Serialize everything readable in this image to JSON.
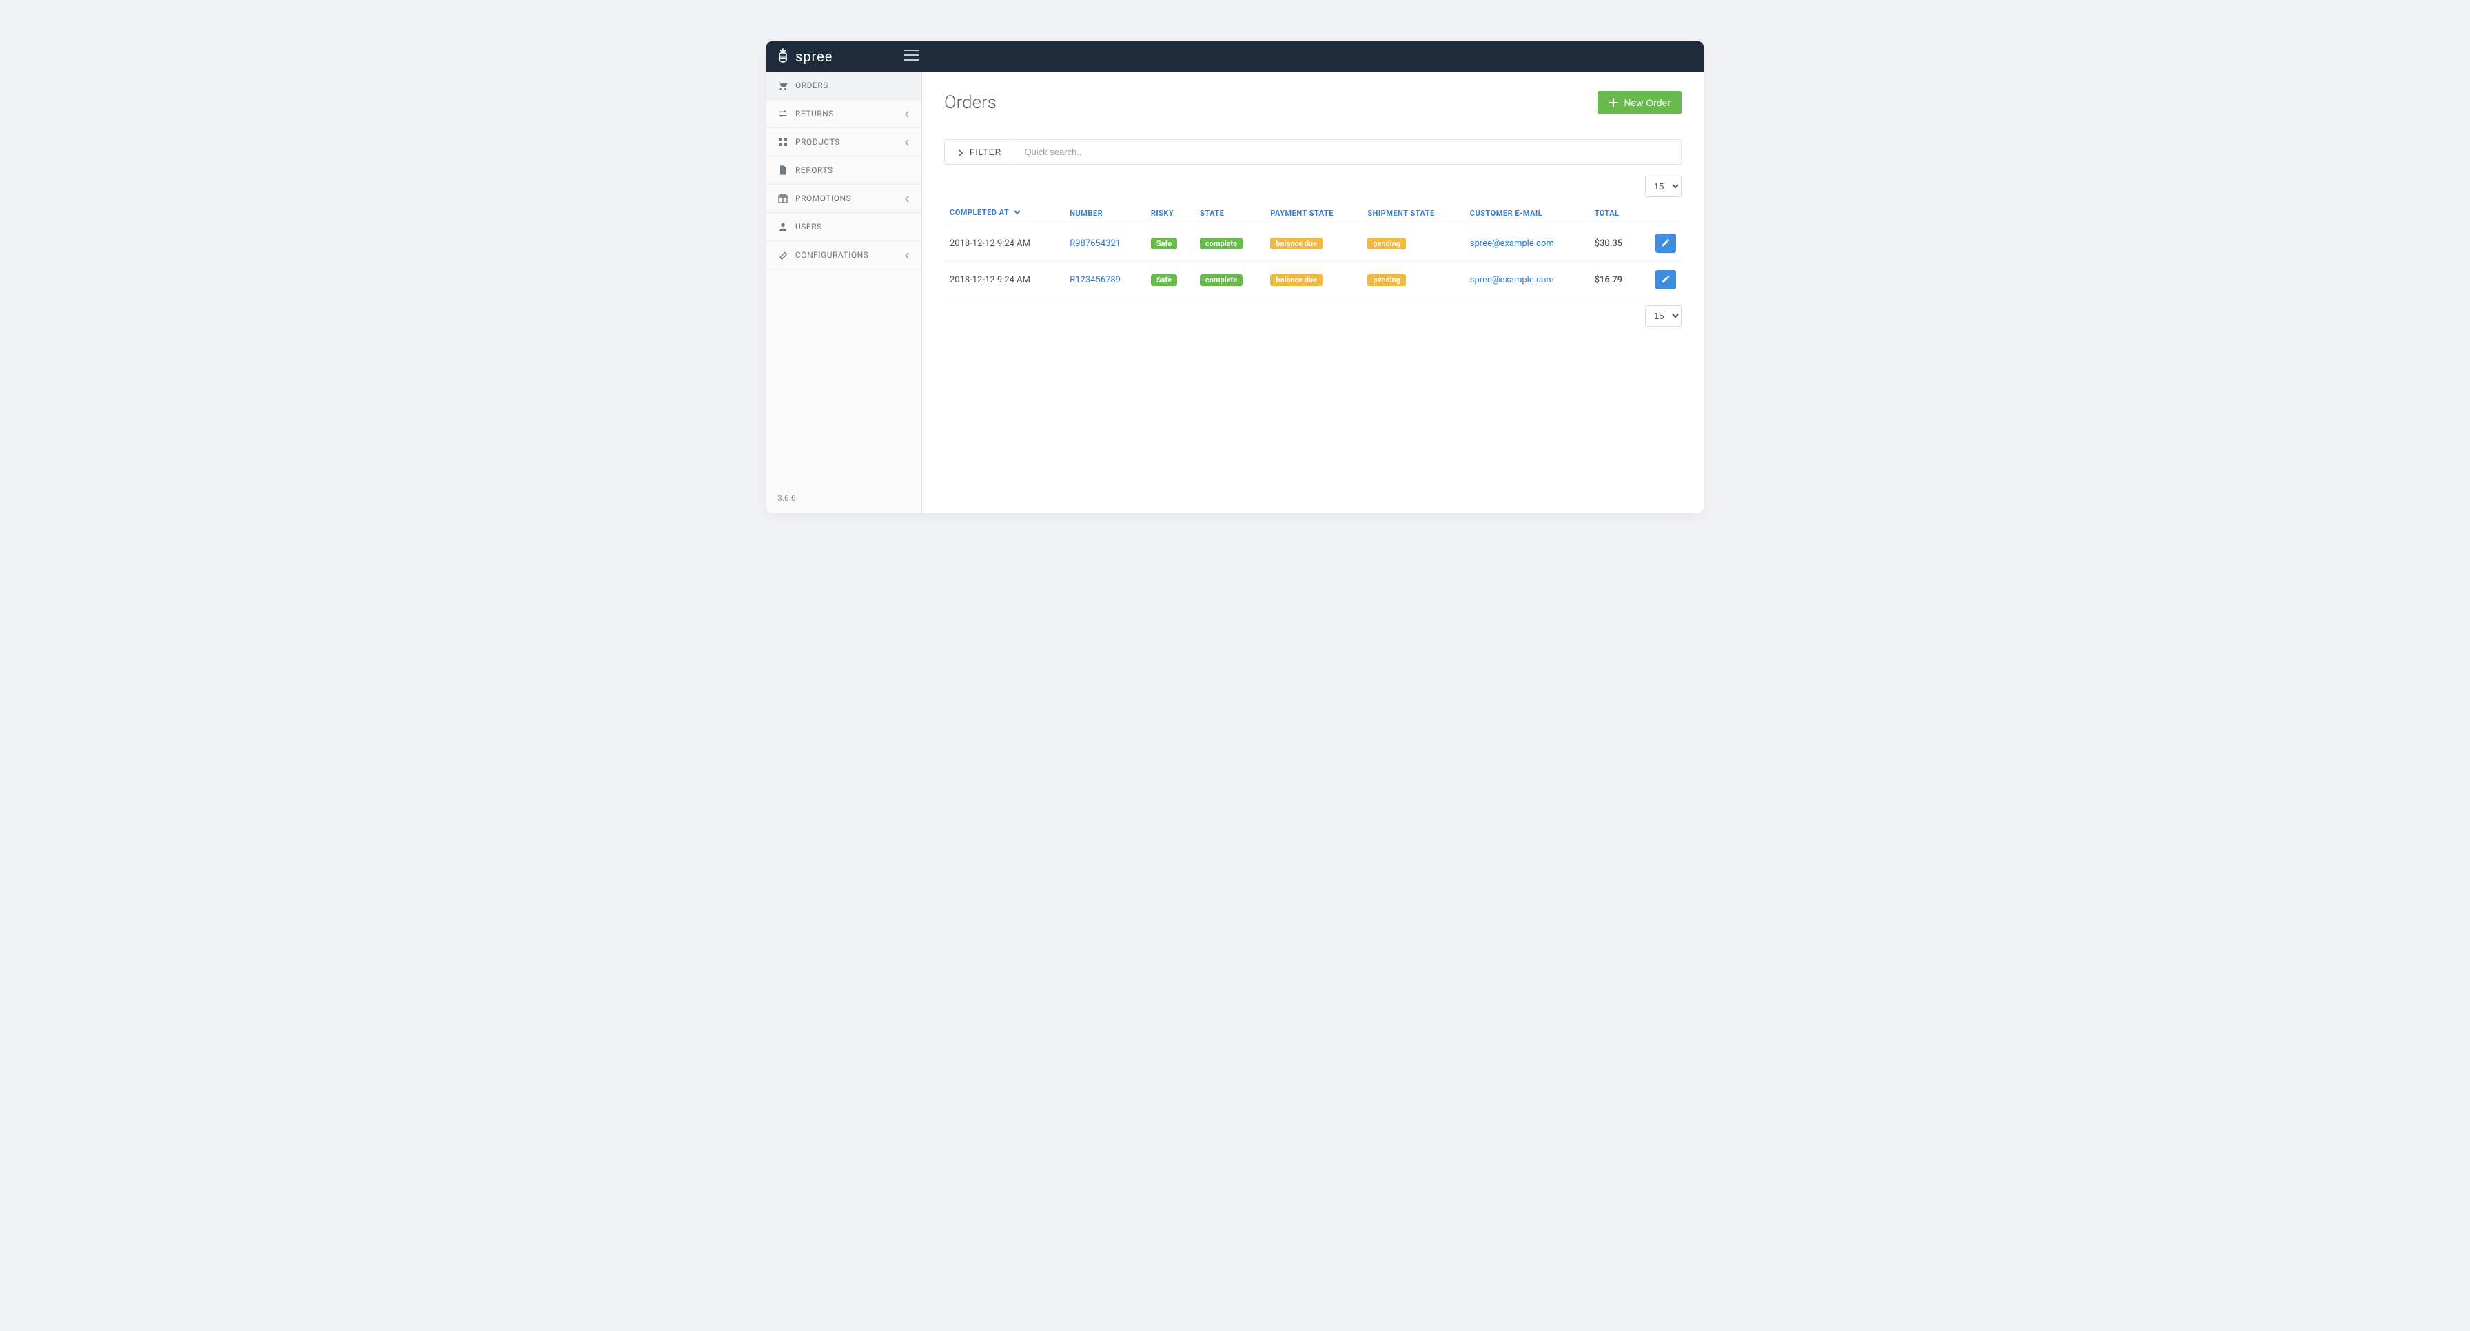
{
  "brand": {
    "name": "spree"
  },
  "sidebar": {
    "items": [
      {
        "label": "ORDERS",
        "has_children": false
      },
      {
        "label": "RETURNS",
        "has_children": true
      },
      {
        "label": "PRODUCTS",
        "has_children": true
      },
      {
        "label": "REPORTS",
        "has_children": false
      },
      {
        "label": "PROMOTIONS",
        "has_children": true
      },
      {
        "label": "USERS",
        "has_children": false
      },
      {
        "label": "CONFIGURATIONS",
        "has_children": true
      }
    ],
    "version": "3.6.6"
  },
  "page": {
    "title": "Orders",
    "new_order_label": "New Order",
    "filter_label": "FILTER",
    "search_placeholder": "Quick search..",
    "per_page": "15",
    "columns": {
      "completed_at": "COMPLETED AT",
      "number": "NUMBER",
      "risky": "RISKY",
      "state": "STATE",
      "payment_state": "PAYMENT STATE",
      "shipment_state": "SHIPMENT STATE",
      "customer_email": "CUSTOMER E-MAIL",
      "total": "TOTAL"
    },
    "rows": [
      {
        "completed_at": "2018-12-12 9:24 AM",
        "number": "R987654321",
        "risky": "Safe",
        "state": "complete",
        "payment_state": "balance due",
        "shipment_state": "pending",
        "customer_email": "spree@example.com",
        "total": "$30.35"
      },
      {
        "completed_at": "2018-12-12 9:24 AM",
        "number": "R123456789",
        "risky": "Safe",
        "state": "complete",
        "payment_state": "balance due",
        "shipment_state": "pending",
        "customer_email": "spree@example.com",
        "total": "$16.79"
      }
    ]
  }
}
